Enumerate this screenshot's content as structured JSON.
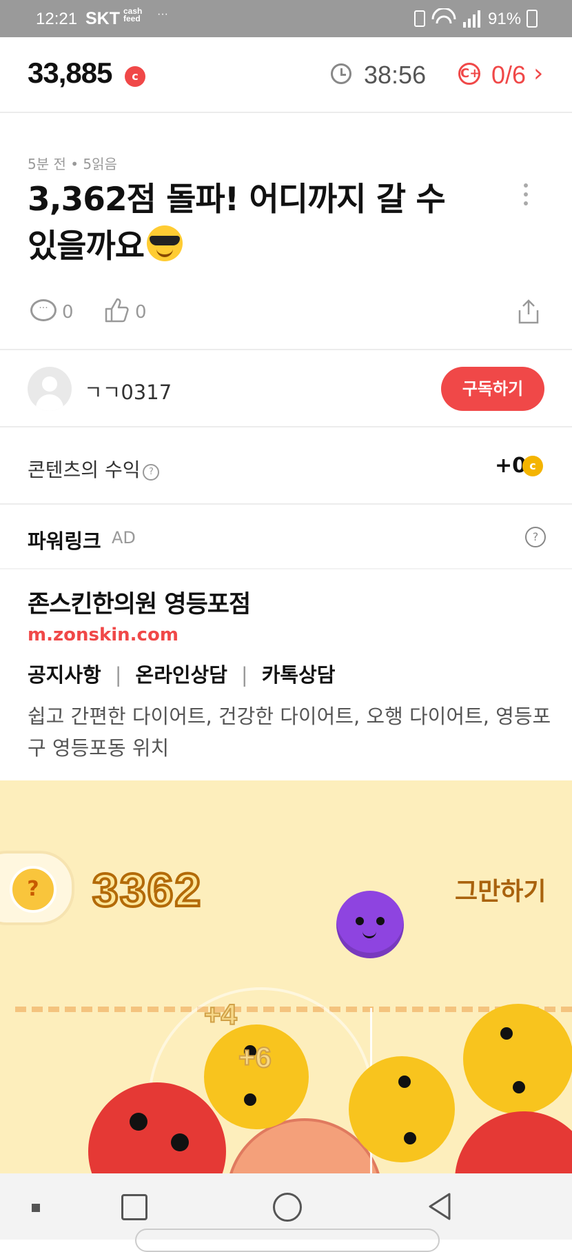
{
  "status_bar": {
    "time": "12:21",
    "carrier": "SKT",
    "cashfeed_line1": "cash",
    "cashfeed_line2": "feed",
    "more": "···",
    "battery": "91%"
  },
  "top_bar": {
    "coin_balance": "33,885",
    "coin_badge": "c",
    "timer": "38:56",
    "mission_icon": "C+",
    "mission_progress": "0/6",
    "mission_chevron": "›"
  },
  "post": {
    "meta": "5분 전 • 5읽음",
    "title": "3,362점 돌파! 어디까지 갈 수 있을까요",
    "comment_icon_glyph": "···",
    "comment_count": "0",
    "like_count": "0"
  },
  "author": {
    "name": "ㄱㄱ0317",
    "subscribe_label": "구독하기"
  },
  "revenue": {
    "label": "콘텐츠의 수익",
    "help": "?",
    "value": "+0",
    "coin": "c"
  },
  "ad": {
    "section_title": "파워링크",
    "tag": "AD",
    "help": "?",
    "name": "존스킨한의원 영등포점",
    "url": "m.zonskin.com",
    "links": [
      "공지사항",
      "온라인상담",
      "카톡상담"
    ],
    "separator": "|",
    "description": "쉽고 간편한 다이어트, 건강한 다이어트, 오행 다이어트, 영등포구 영등포동 위치"
  },
  "game": {
    "help": "?",
    "score": "3362",
    "quit_label": "그만하기",
    "float_bonus_1": "+4",
    "float_bonus_2": "+6",
    "colors": {
      "background": "#fdeebc",
      "purple_ball": "#8e44e0",
      "yellow_ball": "#f8c41e",
      "red_ball": "#e53935",
      "peach_ball": "#f4a07a"
    }
  },
  "icons": {
    "timer": "clock-icon",
    "mission": "coin-plus-icon",
    "comment": "comment-icon",
    "like": "thumbs-up-icon",
    "share": "share-icon",
    "more": "more-vertical-icon"
  }
}
